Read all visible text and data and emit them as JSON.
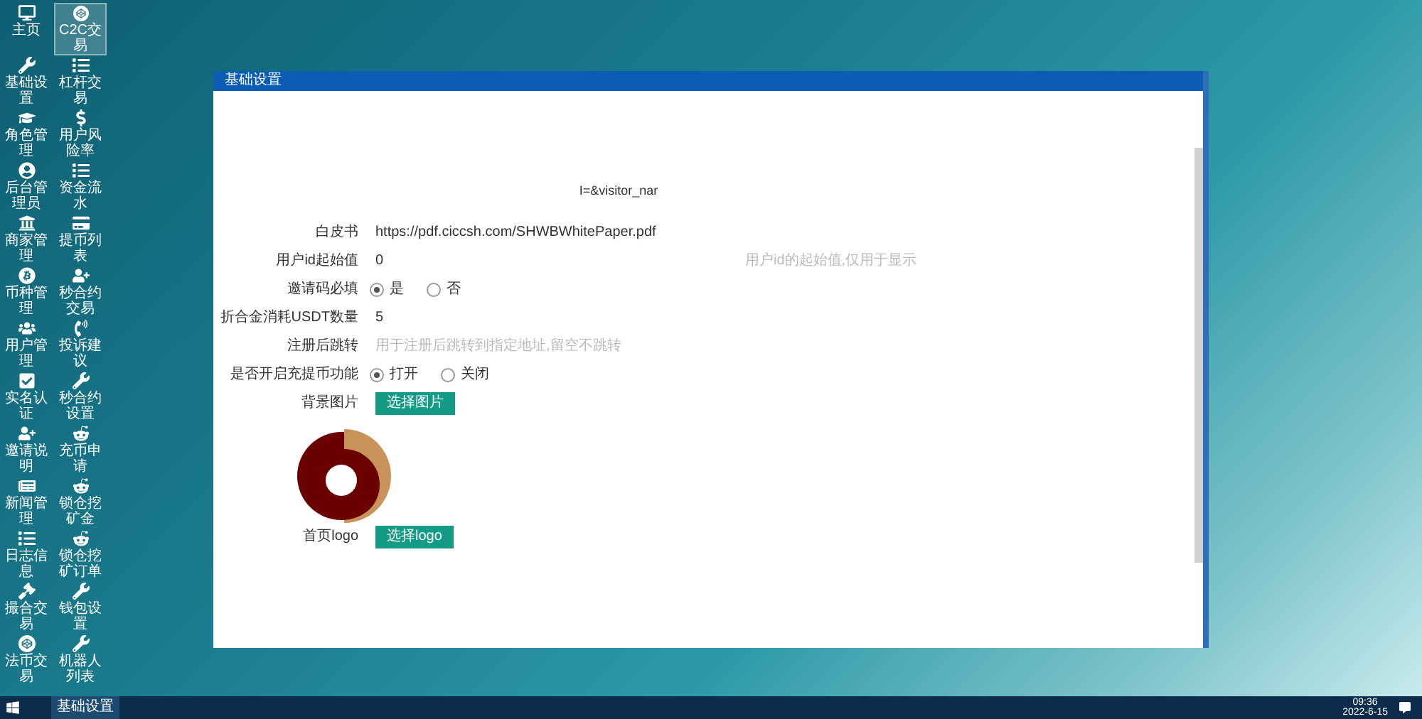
{
  "desktop_icons": [
    {
      "label": "主页",
      "selected": false
    },
    {
      "label": "C2C交易",
      "selected": true
    },
    {
      "label": "基础设置",
      "selected": false
    },
    {
      "label": "杠杆交易",
      "selected": false
    },
    {
      "label": "角色管理",
      "selected": false
    },
    {
      "label": "用户风险率",
      "selected": false
    },
    {
      "label": "后台管理员",
      "selected": false
    },
    {
      "label": "资金流水",
      "selected": false
    },
    {
      "label": "商家管理",
      "selected": false
    },
    {
      "label": "提币列表",
      "selected": false
    },
    {
      "label": "币种管理",
      "selected": false
    },
    {
      "label": "秒合约交易",
      "selected": false
    },
    {
      "label": "用户管理",
      "selected": false
    },
    {
      "label": "投诉建议",
      "selected": false
    },
    {
      "label": "实名认证",
      "selected": false
    },
    {
      "label": "秒合约设置",
      "selected": false
    },
    {
      "label": "邀请说明",
      "selected": false
    },
    {
      "label": "充币申请",
      "selected": false
    },
    {
      "label": "新闻管理",
      "selected": false
    },
    {
      "label": "锁仓挖矿金",
      "selected": false
    },
    {
      "label": "日志信息",
      "selected": false
    },
    {
      "label": "锁仓挖矿订单",
      "selected": false
    },
    {
      "label": "撮合交易",
      "selected": false
    },
    {
      "label": "钱包设置",
      "selected": false
    },
    {
      "label": "法币交易",
      "selected": false
    },
    {
      "label": "机器人列表",
      "selected": false
    }
  ],
  "window": {
    "title": "基础设置",
    "top_text": "I=&visitor_nar",
    "fields": [
      {
        "kind": "text",
        "label": "白皮书",
        "value": "https://pdf.ciccsh.com/SHWBWhitePaper.pdf"
      },
      {
        "kind": "text",
        "label": "用户id起始值",
        "value": "0",
        "hint": "用户id的起始值,仅用于显示"
      },
      {
        "kind": "radio",
        "label": "邀请码必填",
        "options": [
          {
            "label": "是",
            "selected": true
          },
          {
            "label": "否",
            "selected": false
          }
        ]
      },
      {
        "kind": "text",
        "label": "折合金消耗USDT数量",
        "value": "5"
      },
      {
        "kind": "text",
        "label": "注册后跳转",
        "placeholder": "用于注册后跳转到指定地址,留空不跳转"
      },
      {
        "kind": "radio",
        "label": "是否开启充提币功能",
        "options": [
          {
            "label": "打开",
            "selected": true
          },
          {
            "label": "关闭",
            "selected": false
          }
        ]
      },
      {
        "kind": "upload",
        "label": "背景图片",
        "button": "选择图片",
        "image": true
      },
      {
        "kind": "upload",
        "label": "首页logo",
        "button": "选择logo"
      }
    ]
  },
  "taskbar": {
    "task": "基础设置",
    "time": "09:36",
    "date": "2022-6-15"
  }
}
